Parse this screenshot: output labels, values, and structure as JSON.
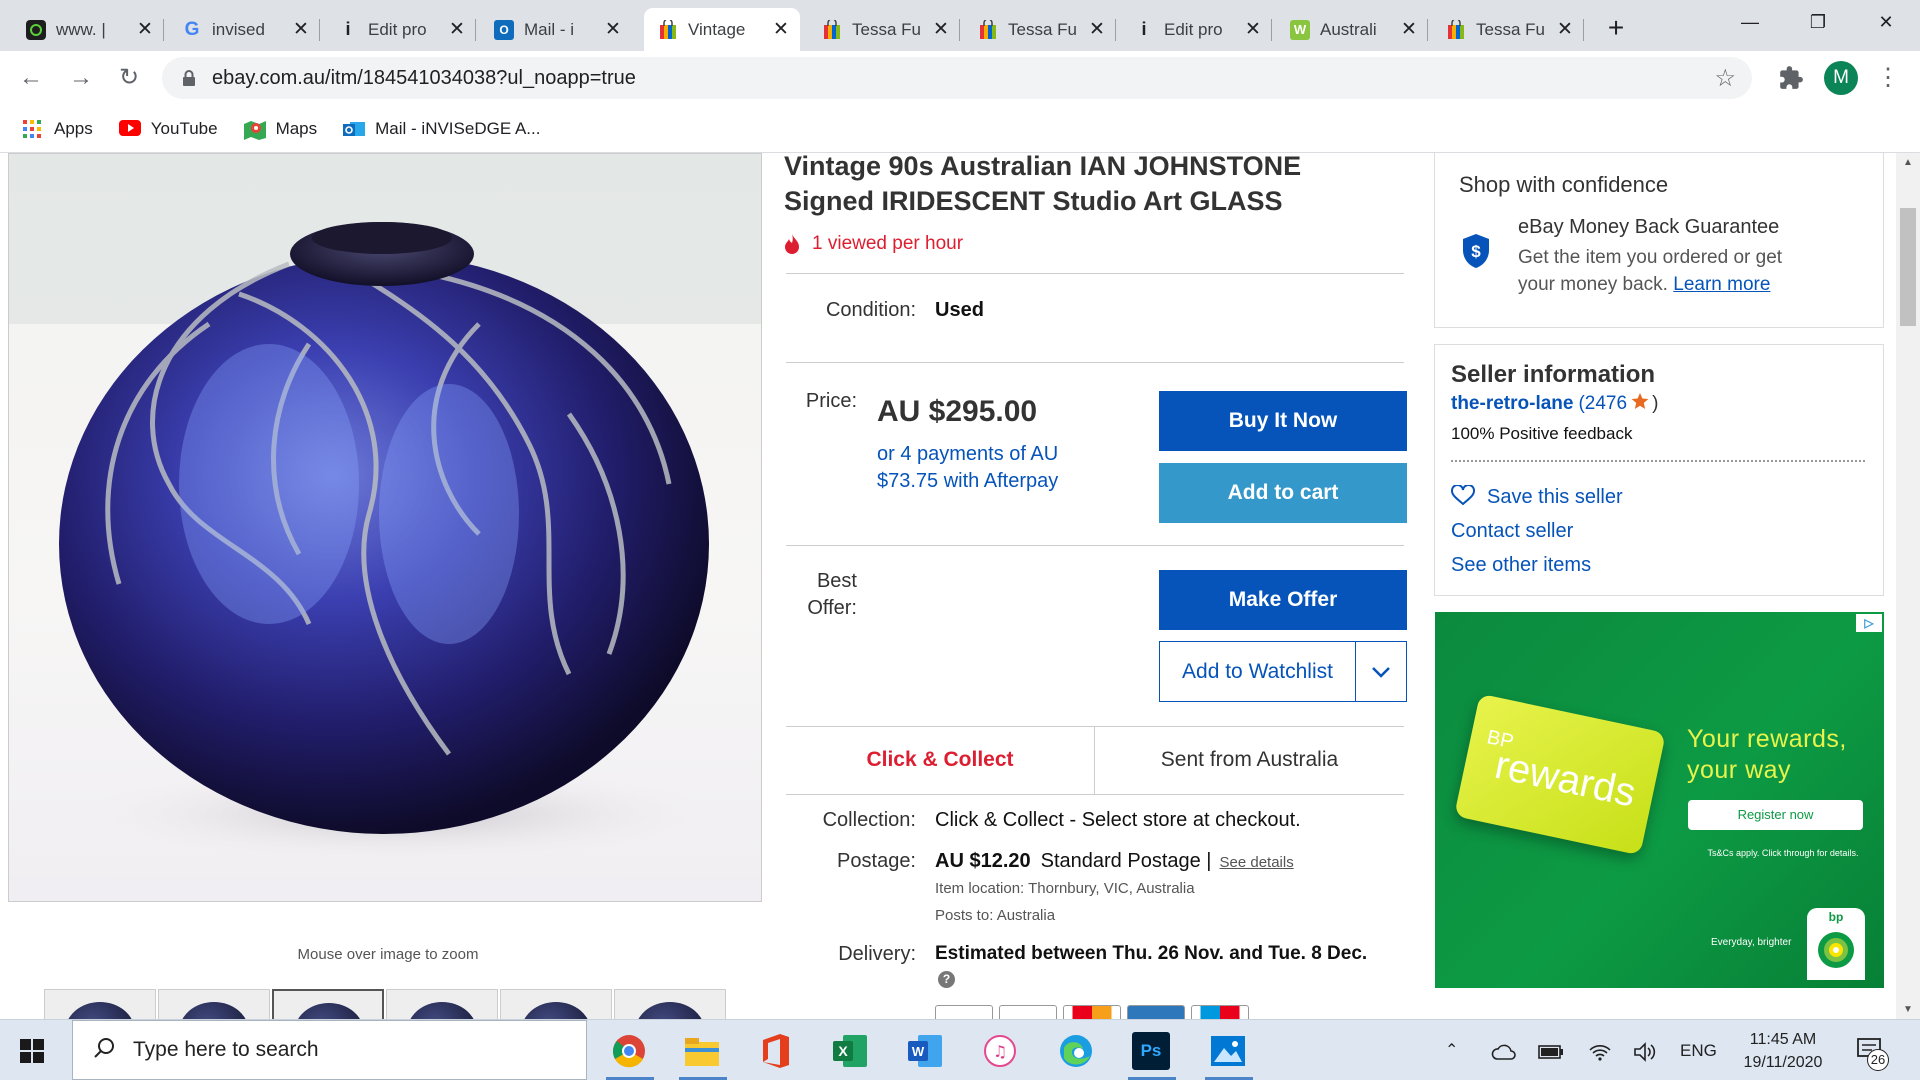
{
  "browser": {
    "tabs": [
      {
        "title": "www. |",
        "icon": "green-app-icon",
        "active": false
      },
      {
        "title": "invised",
        "icon": "google-icon",
        "active": false
      },
      {
        "title": "Edit pro",
        "icon": "info-icon",
        "active": false
      },
      {
        "title": "Mail - i",
        "icon": "outlook-icon",
        "active": false
      },
      {
        "title": "Vintage",
        "icon": "ebay-bag-icon",
        "active": true
      },
      {
        "title": "Tessa Fu",
        "icon": "ebay-bag-icon",
        "active": false
      },
      {
        "title": "Tessa Fu",
        "icon": "ebay-bag-icon",
        "active": false
      },
      {
        "title": "Edit pro",
        "icon": "info-icon",
        "active": false
      },
      {
        "title": "Australi",
        "icon": "woolworths-icon",
        "active": false
      },
      {
        "title": "Tessa Fu",
        "icon": "ebay-bag-icon",
        "active": false
      }
    ],
    "url": "ebay.com.au/itm/184541034038?ul_noapp=true",
    "profile_initial": "M",
    "bookmarks": [
      {
        "label": "Apps",
        "icon": "apps-grid-icon"
      },
      {
        "label": "YouTube",
        "icon": "youtube-icon"
      },
      {
        "label": "Maps",
        "icon": "maps-icon"
      },
      {
        "label": "Mail - iNVISeDGE A...",
        "icon": "outlook-icon"
      }
    ]
  },
  "listing": {
    "title_line1": "Vintage 90s Australian IAN JOHNSTONE",
    "title_line2": "Signed IRIDESCENT Studio Art GLASS",
    "viewed": "1 viewed per hour",
    "condition_label": "Condition:",
    "condition_value": "Used",
    "price_label": "Price:",
    "price": "AU $295.00",
    "afterpay_line1": "or 4 payments of AU",
    "afterpay_line2": "$73.75 with Afterpay",
    "buy_now": "Buy It Now",
    "add_to_cart": "Add to cart",
    "best_offer_label_1": "Best",
    "best_offer_label_2": "Offer:",
    "make_offer": "Make Offer",
    "add_to_watchlist": "Add to Watchlist",
    "tab_click_collect": "Click & Collect",
    "tab_sent_from": "Sent from Australia",
    "collection_label": "Collection:",
    "collection_value": "Click & Collect - Select store at checkout.",
    "postage_label": "Postage:",
    "postage_price": "AU $12.20",
    "postage_service": "Standard Postage |",
    "see_details": "See details",
    "item_location": "Item location:  Thornbury, VIC, Australia",
    "posts_to": "Posts to:  Australia",
    "delivery_label": "Delivery:",
    "delivery_value": "Estimated between Thu. 26 Nov. and Tue. 8 Dec.",
    "zoom_hint": "Mouse over image to zoom"
  },
  "sidebar": {
    "confidence_title": "Shop with confidence",
    "guarantee_title": "eBay Money Back Guarantee",
    "guarantee_line1": "Get the item you ordered or get",
    "guarantee_line2": "your money back.",
    "learn_more": "Learn more",
    "seller_title": "Seller information",
    "seller_name": "the-retro-lane",
    "feedback_score": "(2476",
    "feedback_close": ")",
    "positive_feedback": "100% Positive feedback",
    "save_seller": "Save this seller",
    "contact_seller": "Contact seller",
    "see_other_items": "See other items"
  },
  "ad": {
    "card_bp": "BP",
    "card_rewards": "rewards",
    "headline_1": "Your rewards,",
    "headline_2": "your way",
    "cta": "Register now",
    "fineprint": "Ts&Cs apply. Click through for details.",
    "tagline": "Everyday, brighter",
    "bp_logo_text": "bp"
  },
  "taskbar": {
    "search_placeholder": "Type here to search",
    "language": "ENG",
    "time": "11:45 AM",
    "date": "19/11/2020",
    "notification_count": "26",
    "apps": [
      "chrome-icon",
      "file-explorer-icon",
      "office-icon",
      "excel-icon",
      "word-icon",
      "itunes-icon",
      "edge-icon",
      "photoshop-icon",
      "photos-icon"
    ]
  },
  "colors": {
    "ebay_blue": "#0654ba",
    "ebay_light_blue": "#3498ca",
    "ebay_red": "#dd1e31",
    "ad_green": "#0d9a44"
  }
}
